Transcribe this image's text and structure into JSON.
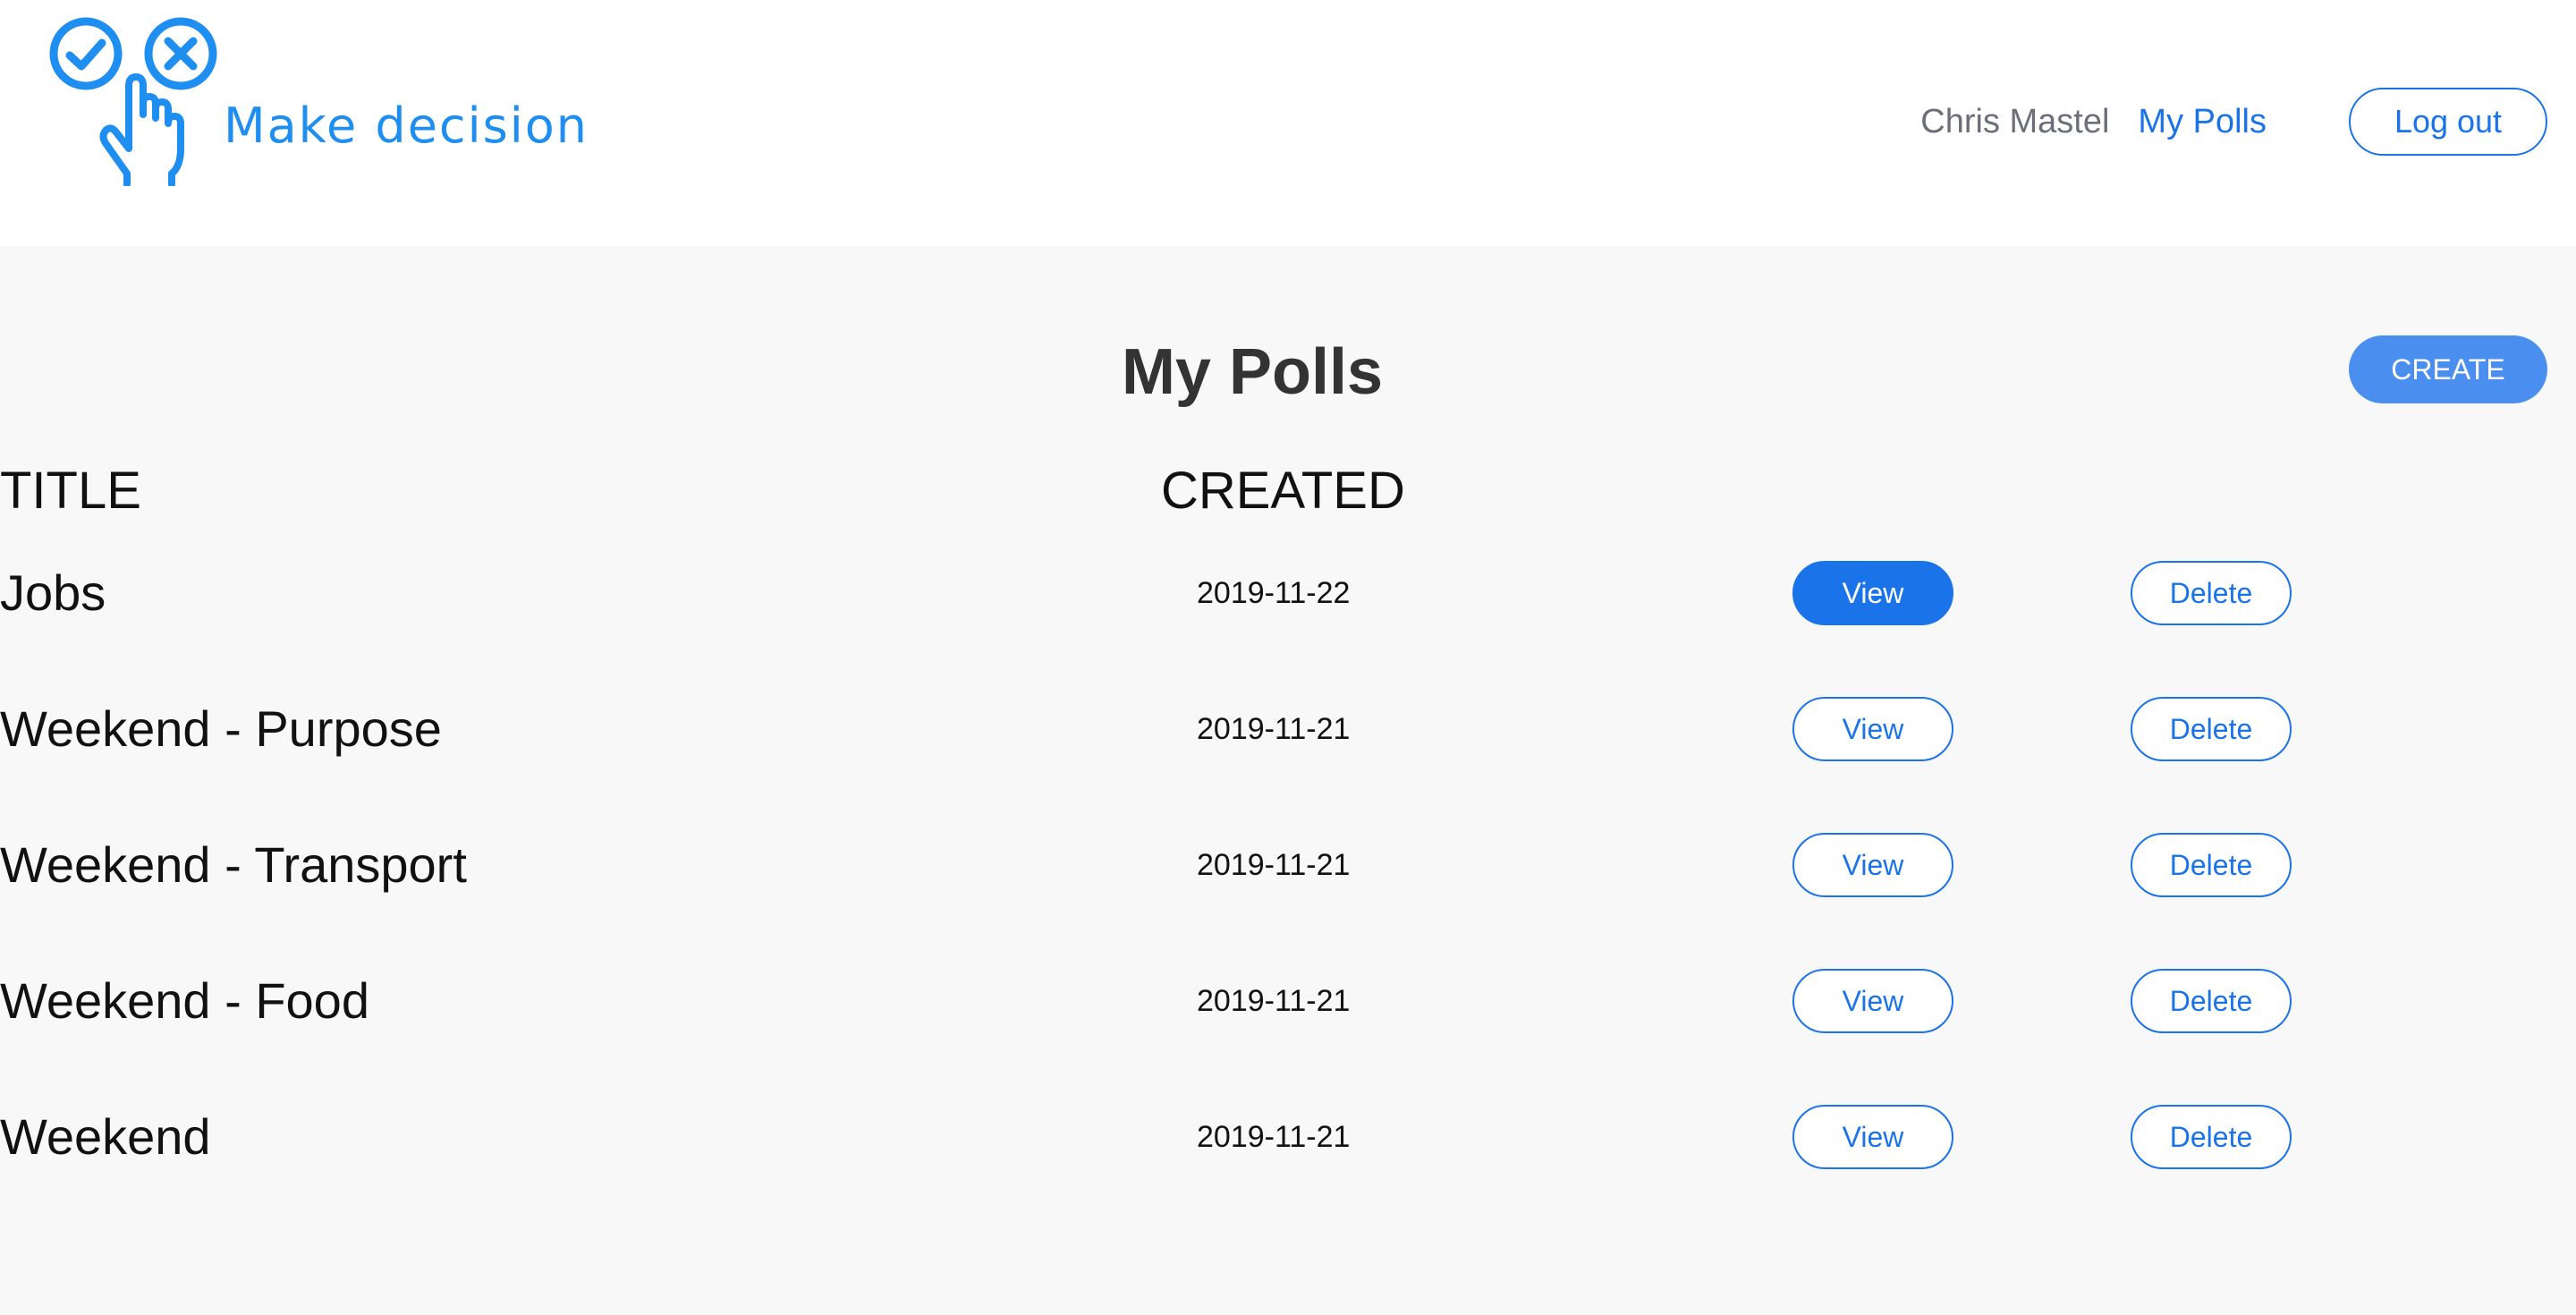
{
  "brand": {
    "logo_icon": "hand-check-x-icon",
    "name": "Make decision",
    "color": "#1e8ef0"
  },
  "nav": {
    "user_name": "Chris Mastel",
    "my_polls_link": "My Polls",
    "logout_label": "Log out"
  },
  "page": {
    "title": "My Polls",
    "create_label": "CREATE"
  },
  "table": {
    "headers": {
      "title": "TITLE",
      "created": "CREATED"
    },
    "rows": [
      {
        "title": "Jobs",
        "created": "2019-11-22",
        "view_label": "View",
        "delete_label": "Delete",
        "view_active": true
      },
      {
        "title": "Weekend - Purpose",
        "created": "2019-11-21",
        "view_label": "View",
        "delete_label": "Delete",
        "view_active": false
      },
      {
        "title": "Weekend - Transport",
        "created": "2019-11-21",
        "view_label": "View",
        "delete_label": "Delete",
        "view_active": false
      },
      {
        "title": "Weekend - Food",
        "created": "2019-11-21",
        "view_label": "View",
        "delete_label": "Delete",
        "view_active": false
      },
      {
        "title": "Weekend",
        "created": "2019-11-21",
        "view_label": "View",
        "delete_label": "Delete",
        "view_active": false
      }
    ]
  },
  "colors": {
    "accent": "#1a73e8",
    "create_button": "#4a8ff0",
    "main_background": "#f8f8f8"
  }
}
